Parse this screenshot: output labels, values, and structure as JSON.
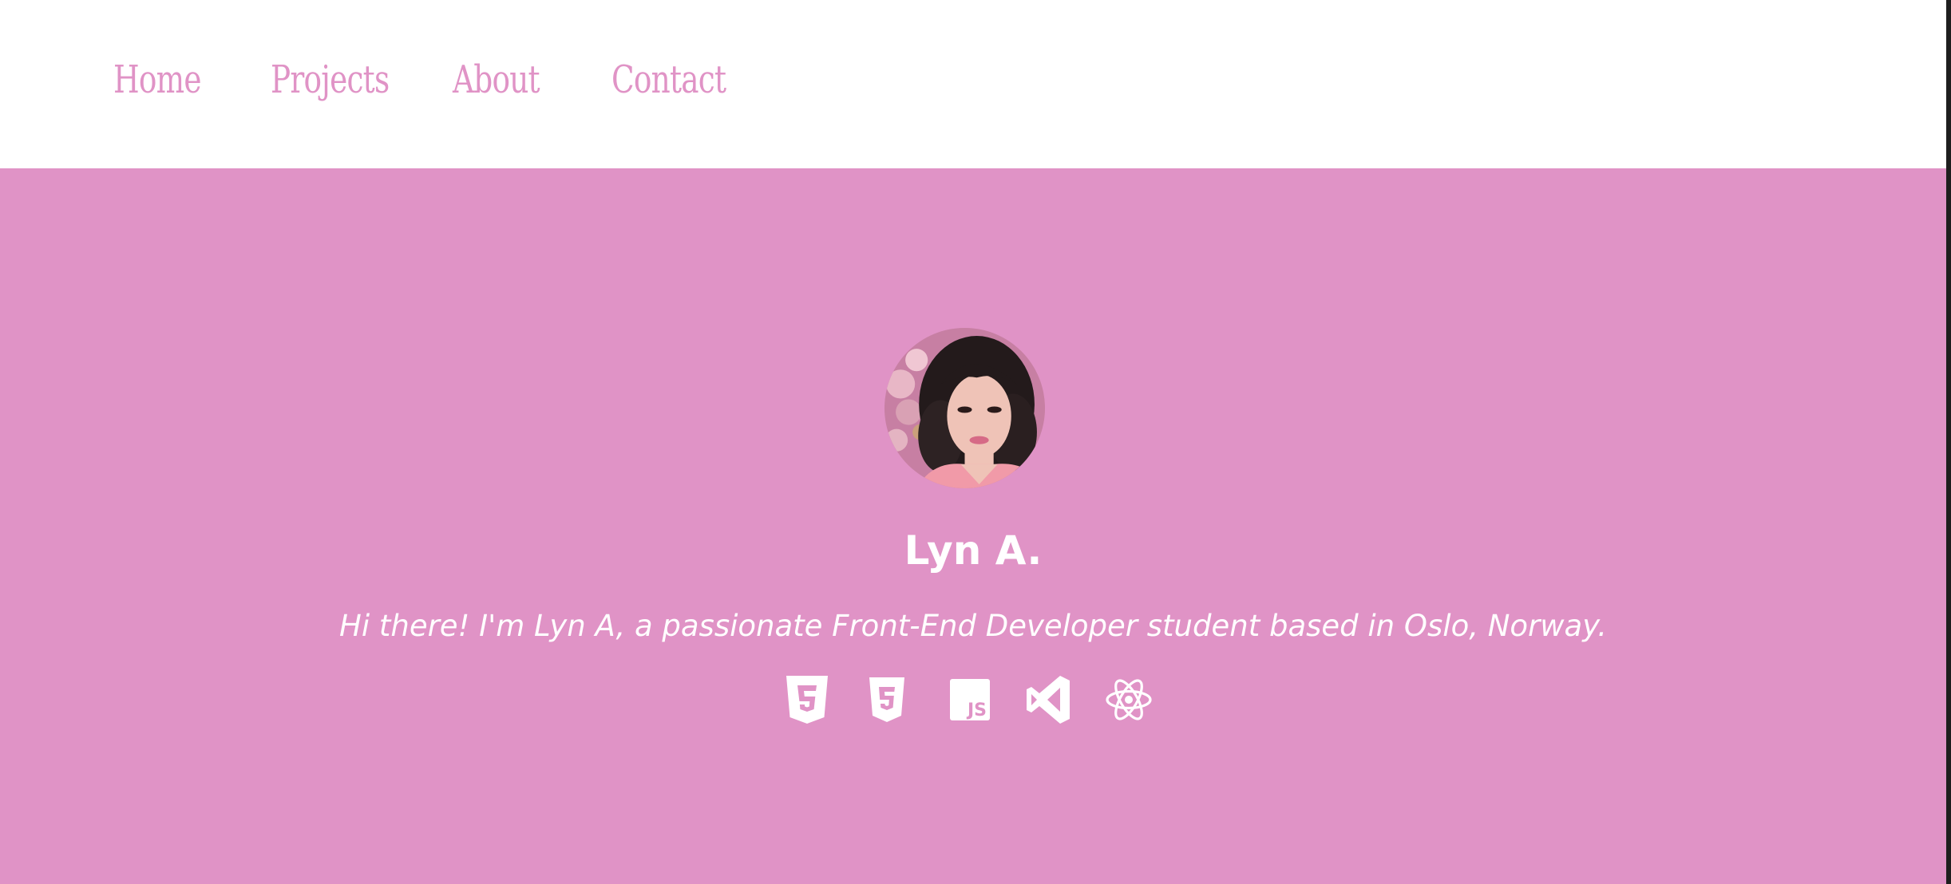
{
  "nav": {
    "items": [
      {
        "label": "Home"
      },
      {
        "label": "Projects"
      },
      {
        "label": "About"
      },
      {
        "label": "Contact"
      }
    ]
  },
  "hero": {
    "name": "Lyn A.",
    "tagline": "Hi there! I'm Lyn A, a passionate Front-End Developer student based in Oslo, Norway.",
    "avatar_icon": "profile-photo",
    "tech_icons": [
      "html5-icon",
      "css3-icon",
      "javascript-icon",
      "visual-studio-icon",
      "react-icon"
    ]
  },
  "colors": {
    "accent": "#e093c6",
    "navbar_bg": "#ffffff",
    "text_on_accent": "#ffffff"
  }
}
